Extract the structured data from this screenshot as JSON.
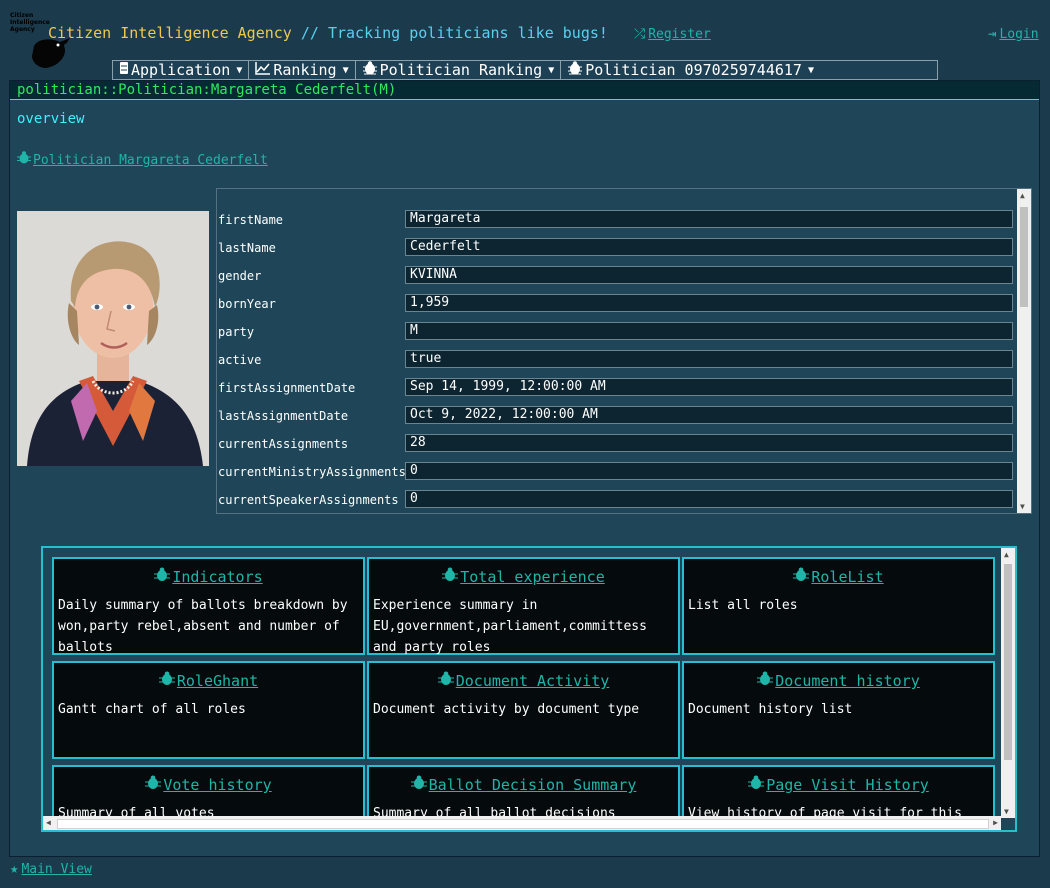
{
  "header": {
    "logo_text": [
      "Citizen",
      "Intelligence",
      "Agency"
    ],
    "tagline_brand": "Citizen Intelligence Agency",
    "tagline_rest": " // Tracking politicians like bugs!",
    "register_label": "Register",
    "login_label": "Login"
  },
  "menubar": {
    "items": [
      {
        "label": "Application",
        "icon": "server-icon"
      },
      {
        "label": "Ranking",
        "icon": "line-chart-icon"
      },
      {
        "label": "Politician Ranking",
        "icon": "bug-icon"
      },
      {
        "label": "Politician 0970259744617",
        "icon": "bug-icon"
      }
    ]
  },
  "panel": {
    "title": "politician::Politician:Margareta Cederfelt(M)",
    "section": "overview",
    "politician_link": "Politician Margareta Cederfelt"
  },
  "form": {
    "fields": [
      {
        "label": "firstName",
        "value": "Margareta"
      },
      {
        "label": "lastName",
        "value": "Cederfelt"
      },
      {
        "label": "gender",
        "value": "KVINNA"
      },
      {
        "label": "bornYear",
        "value": "1,959"
      },
      {
        "label": "party",
        "value": "M"
      },
      {
        "label": "active",
        "value": "true"
      },
      {
        "label": "firstAssignmentDate",
        "value": "Sep 14, 1999, 12:00:00 AM"
      },
      {
        "label": "lastAssignmentDate",
        "value": "Oct 9, 2022, 12:00:00 AM"
      },
      {
        "label": "currentAssignments",
        "value": "28"
      },
      {
        "label": "currentMinistryAssignments",
        "value": "0"
      },
      {
        "label": "currentSpeakerAssignments",
        "value": "0"
      }
    ]
  },
  "cards": [
    {
      "title": "Indicators",
      "desc": "Daily summary of ballots breakdown by won,party rebel,absent and number of ballots"
    },
    {
      "title": "Total experience",
      "desc": "Experience summary in EU,government,parliament,committess and party roles"
    },
    {
      "title": "RoleList",
      "desc": "List all roles"
    },
    {
      "title": "RoleGhant",
      "desc": "Gantt chart of all roles"
    },
    {
      "title": "Document Activity",
      "desc": "Document activity by document type"
    },
    {
      "title": "Document history",
      "desc": "Document history list"
    },
    {
      "title": "Vote history",
      "desc": "Summary of all votes"
    },
    {
      "title": "Ballot Decision Summary",
      "desc": "Summary of all ballot decisions"
    },
    {
      "title": "Page Visit History",
      "desc": "View history of page visit for this page."
    }
  ],
  "footer": {
    "main_view_label": "Main View"
  },
  "colors": {
    "background": "#1b3a4c",
    "accent": "#1fb5a8",
    "title_green": "#30e860",
    "card_border": "#24c0d0"
  }
}
